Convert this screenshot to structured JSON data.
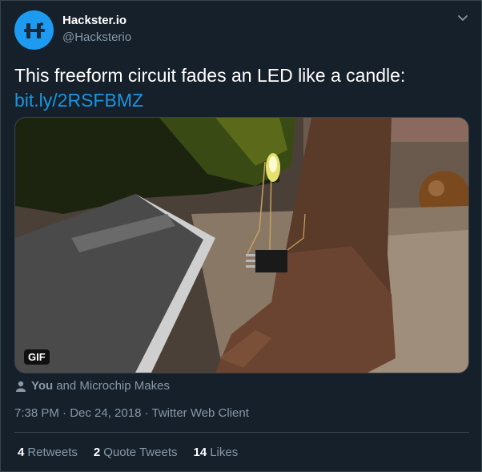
{
  "author": {
    "name": "Hackster.io",
    "handle": "@Hacksterio"
  },
  "tweet": {
    "text": "This freeform circuit fades an LED like a candle:",
    "link": "bit.ly/2RSFBMZ"
  },
  "media": {
    "badge": "GIF"
  },
  "social_context": {
    "you": "You",
    "rest": "and Microchip Makes"
  },
  "meta": {
    "timestamp": "7:38 PM · Dec 24, 2018 · Twitter Web Client"
  },
  "stats": {
    "retweets_count": "4",
    "retweets_label": "Retweets",
    "quotes_count": "2",
    "quotes_label": "Quote Tweets",
    "likes_count": "14",
    "likes_label": "Likes"
  },
  "colors": {
    "background": "#15202b",
    "link": "#1b95e0",
    "secondary_text": "#8899a6",
    "divider": "#38444d"
  }
}
